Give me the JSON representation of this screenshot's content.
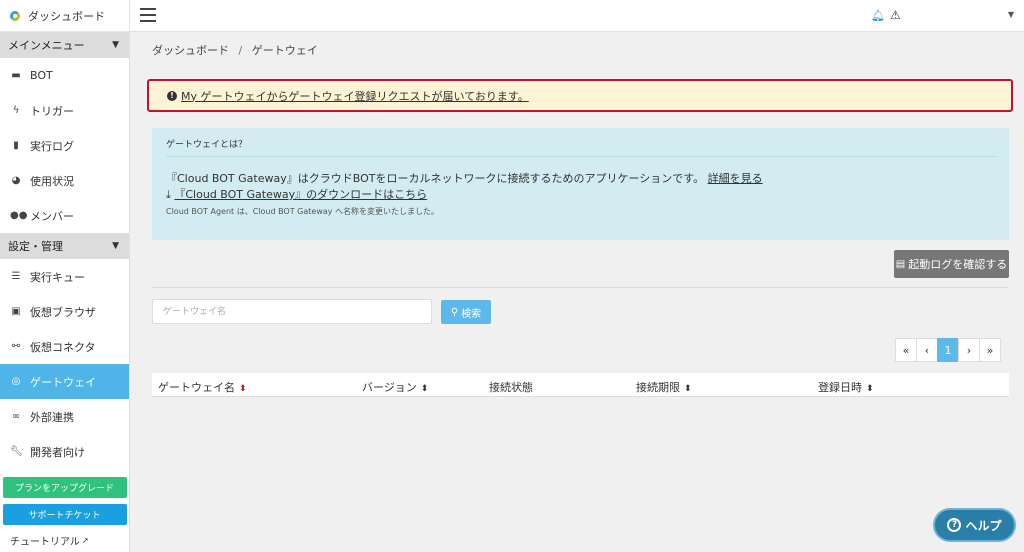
{
  "sidebar": {
    "brand": "ダッシュボード",
    "sections": [
      {
        "label": "メインメニュー"
      },
      {
        "label": "設定・管理"
      }
    ],
    "items": [
      {
        "label": "BOT",
        "icon": "robot-icon"
      },
      {
        "label": "トリガー",
        "icon": "bolt-icon"
      },
      {
        "label": "実行ログ",
        "icon": "file-icon"
      },
      {
        "label": "使用状況",
        "icon": "pie-chart-icon"
      },
      {
        "label": "メンバー",
        "icon": "users-icon"
      },
      {
        "label": "実行キュー",
        "icon": "list-icon"
      },
      {
        "label": "仮想ブラウザ",
        "icon": "browser-icon"
      },
      {
        "label": "仮想コネクタ",
        "icon": "connector-icon"
      },
      {
        "label": "ゲートウェイ",
        "icon": "gateway-icon"
      },
      {
        "label": "外部連携",
        "icon": "link-icon"
      },
      {
        "label": "開発者向け",
        "icon": "wrench-icon"
      }
    ],
    "upgrade_label": "プランをアップグレード",
    "support_label": "サポートチケット",
    "tutorial_label": "チュートリアル"
  },
  "breadcrumb": {
    "root": "ダッシュボード",
    "current": "ゲートウェイ"
  },
  "alert": {
    "text": "My ゲートウェイからゲートウェイ登録リクエストが届いております。"
  },
  "info": {
    "title": "ゲートウェイとは？",
    "line1": "『Cloud BOT Gateway』はクラウドBOTをローカルネットワークに接続するためのアプリケーションです。",
    "details_link": "詳細を見る",
    "download_link": "『Cloud BOT Gateway』のダウンロードはこちら",
    "note": "Cloud BOT Agent は、Cloud BOT Gateway へ名称を変更いたしました。"
  },
  "log_button": "起動ログを確認する",
  "search": {
    "placeholder": "ゲートウェイ名",
    "button": "検索"
  },
  "pagination": {
    "first": "«",
    "prev": "‹",
    "current": "1",
    "next": "›",
    "last": "»"
  },
  "table": {
    "columns": [
      "ゲートウェイ名",
      "バージョン",
      "接続状態",
      "接続期限",
      "登録日時"
    ]
  },
  "help": {
    "label": "ヘルプ"
  },
  "colors": {
    "accent": "#4fb4e8",
    "alert_border": "#c8102e",
    "upgrade": "#2ec27e",
    "support": "#1aa0e0"
  }
}
